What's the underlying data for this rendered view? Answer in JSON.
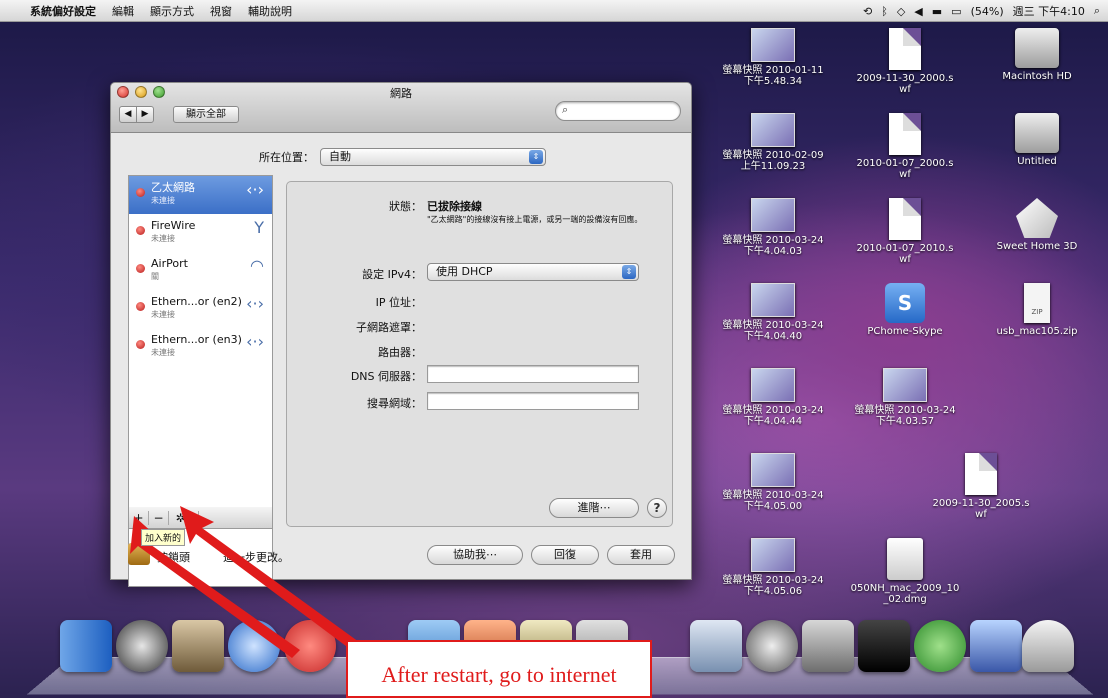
{
  "menubar": {
    "apple": "",
    "app_name": "系統偏好設定",
    "menus": [
      "編輯",
      "顯示方式",
      "視窗",
      "輔助說明"
    ],
    "battery": "(54%)",
    "clock": "週三 下午4:10"
  },
  "desktop": {
    "icons": [
      {
        "label": "螢幕快照 2010-01-11\n下午5.48.34",
        "kind": "thumb"
      },
      {
        "label": "2009-11-30_2000.s\nwf",
        "kind": "doc"
      },
      {
        "label": "Macintosh HD",
        "kind": "hd"
      },
      {
        "label": "螢幕快照 2010-02-09\n上午11.09.23",
        "kind": "thumb"
      },
      {
        "label": "2010-01-07_2000.s\nwf",
        "kind": "doc"
      },
      {
        "label": "Untitled",
        "kind": "hd"
      },
      {
        "label": "螢幕快照 2010-03-24\n下午4.04.03",
        "kind": "thumb"
      },
      {
        "label": "2010-01-07_2010.s\nwf",
        "kind": "doc"
      },
      {
        "label": "Sweet Home 3D",
        "kind": "house"
      },
      {
        "label": "螢幕快照 2010-03-24\n下午4.04.40",
        "kind": "thumb"
      },
      {
        "label": "PChome-Skype",
        "kind": "app"
      },
      {
        "label": "usb_mac105.zip",
        "kind": "zip"
      },
      {
        "label": "螢幕快照 2010-03-24\n下午4.04.44",
        "kind": "thumb"
      },
      {
        "label": "螢幕快照 2010-03-24\n下午4.03.57",
        "kind": "thumb"
      },
      {
        "label": "螢幕快照 2010-03-24\n下午4.05.00",
        "kind": "thumb"
      },
      {
        "label": "2009-11-30_2005.s\nwf",
        "kind": "doc"
      },
      {
        "label": "螢幕快照 2010-03-24\n下午4.05.06",
        "kind": "thumb"
      },
      {
        "label": "050NH_mac_2009_10\n_02.dmg",
        "kind": "dmg"
      }
    ]
  },
  "window": {
    "title": "網路",
    "show_all": "顯示全部",
    "location_label": "所在位置：",
    "location_value": "自動",
    "services": [
      {
        "name": "乙太網路",
        "status": "未連接",
        "icon": "ethernet-icon"
      },
      {
        "name": "FireWire",
        "status": "未連接",
        "icon": "firewire-icon"
      },
      {
        "name": "AirPort",
        "status": "關",
        "icon": "wifi-icon"
      },
      {
        "name": "Ethern...or (en2)",
        "status": "未連接",
        "icon": "ethernet-icon"
      },
      {
        "name": "Ethern...or (en3)",
        "status": "未連接",
        "icon": "ethernet-icon"
      }
    ],
    "list_tools": [
      "+",
      "−",
      "✲▾"
    ],
    "detail": {
      "status_label": "狀態：",
      "status_value": "已拔除接線",
      "status_note": "\"乙太網路\"的接線沒有接上電源，或另一端的設備沒有回應。",
      "ipv4_label": "設定 IPv4：",
      "ipv4_value": "使用 DHCP",
      "ip_label": "IP 位址：",
      "subnet_label": "子網路遮罩：",
      "router_label": "路由器：",
      "dns_label": "DNS 伺服器：",
      "search_label": "搜尋網域：",
      "advanced": "進階⋯",
      "help": "?"
    },
    "tooltip": "加入新的",
    "lock_text": "按鎖頭",
    "lock_text2": "進一步更改。",
    "assist": "協助我⋯",
    "revert": "回復",
    "apply": "套用"
  },
  "annotation": {
    "text": "After restart, go to internet"
  }
}
